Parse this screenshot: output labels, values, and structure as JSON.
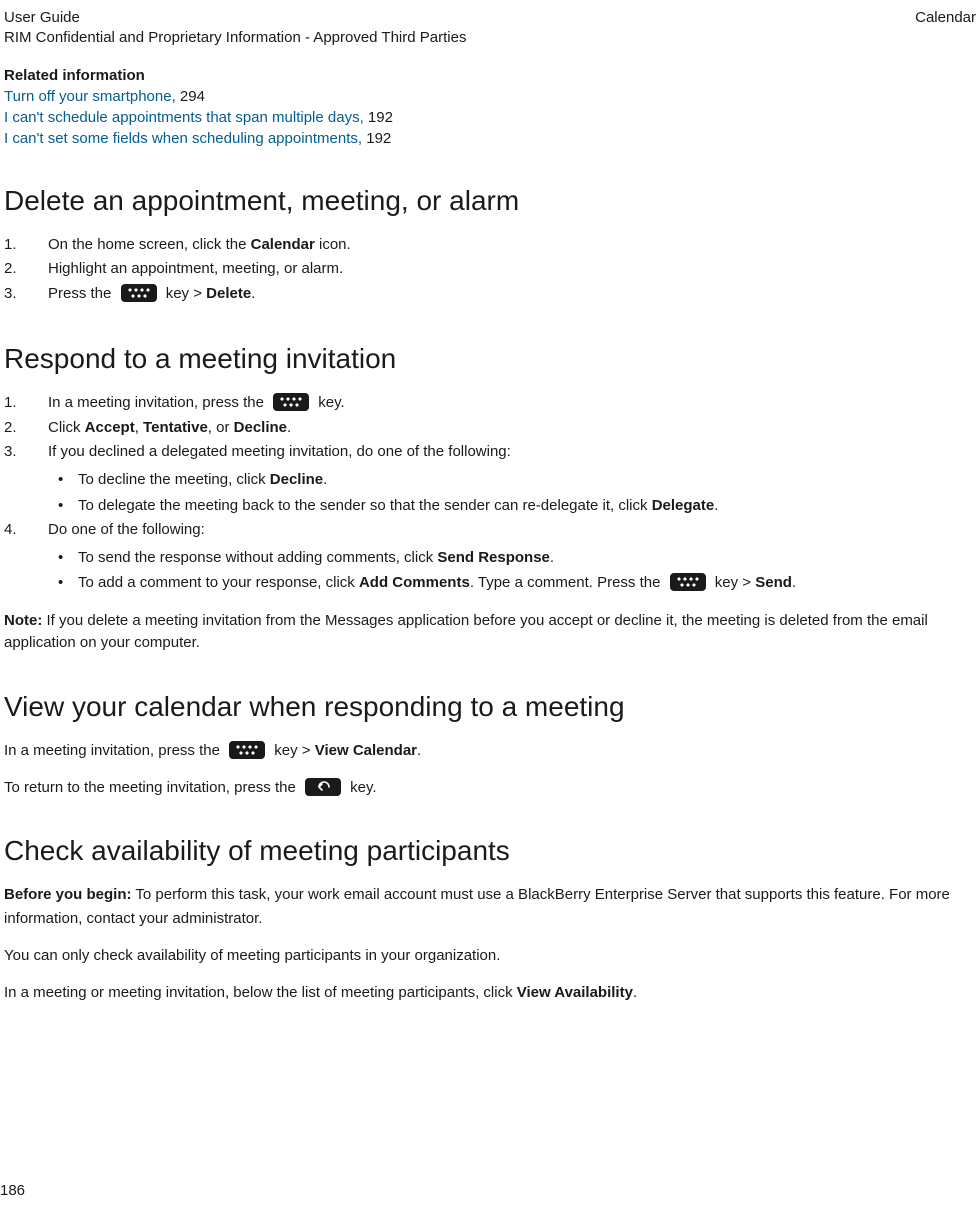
{
  "header": {
    "left_line1": "User Guide",
    "left_line2": "RIM Confidential and Proprietary Information - Approved Third Parties",
    "right": "Calendar"
  },
  "related": {
    "heading": "Related information",
    "items": [
      {
        "text": "Turn off your smartphone,",
        "page": " 294"
      },
      {
        "text": "I can't schedule appointments that span multiple days,",
        "page": " 192"
      },
      {
        "text": "I can't set some fields when scheduling appointments,",
        "page": " 192"
      }
    ]
  },
  "s1": {
    "title": "Delete an appointment, meeting, or alarm",
    "step1_a": "On the home screen, click the ",
    "step1_b": "Calendar",
    "step1_c": " icon.",
    "step2": "Highlight an appointment, meeting, or alarm.",
    "step3_a": "Press the ",
    "step3_b": " key > ",
    "step3_c": "Delete",
    "step3_d": "."
  },
  "s2": {
    "title": "Respond to a meeting invitation",
    "step1_a": "In a meeting invitation, press the ",
    "step1_b": " key.",
    "step2_a": "Click ",
    "step2_b": "Accept",
    "step2_c": ", ",
    "step2_d": "Tentative",
    "step2_e": ", or ",
    "step2_f": "Decline",
    "step2_g": ".",
    "step3": "If you declined a delegated meeting invitation, do one of the following:",
    "step3_b1_a": "To decline the meeting, click ",
    "step3_b1_b": "Decline",
    "step3_b1_c": ".",
    "step3_b2_a": "To delegate the meeting back to the sender so that the sender can re-delegate it, click ",
    "step3_b2_b": "Delegate",
    "step3_b2_c": ".",
    "step4": "Do one of the following:",
    "step4_b1_a": "To send the response without adding comments, click ",
    "step4_b1_b": "Send Response",
    "step4_b1_c": ".",
    "step4_b2_a": "To add a comment to your response, click ",
    "step4_b2_b": "Add Comments",
    "step4_b2_c": ". Type a comment. Press the ",
    "step4_b2_d": " key > ",
    "step4_b2_e": "Send",
    "step4_b2_f": ".",
    "note_a": "Note:",
    "note_b": " If you delete a meeting invitation from the Messages application before you accept or decline it, the meeting is deleted from the email application on your computer."
  },
  "s3": {
    "title": "View your calendar when responding to a meeting",
    "p1_a": "In a meeting invitation, press the ",
    "p1_b": " key > ",
    "p1_c": "View Calendar",
    "p1_d": ".",
    "p2_a": "To return to the meeting invitation, press the ",
    "p2_b": " key."
  },
  "s4": {
    "title": "Check availability of meeting participants",
    "p1_a": "Before you begin:",
    "p1_b": " To perform this task, your work email account must use a BlackBerry Enterprise Server that supports this feature. For more information, contact your administrator.",
    "p2": "You can only check availability of meeting participants in your organization.",
    "p3_a": "In a meeting or meeting invitation, below the list of meeting participants, click ",
    "p3_b": "View Availability",
    "p3_c": "."
  },
  "page_number": "186"
}
